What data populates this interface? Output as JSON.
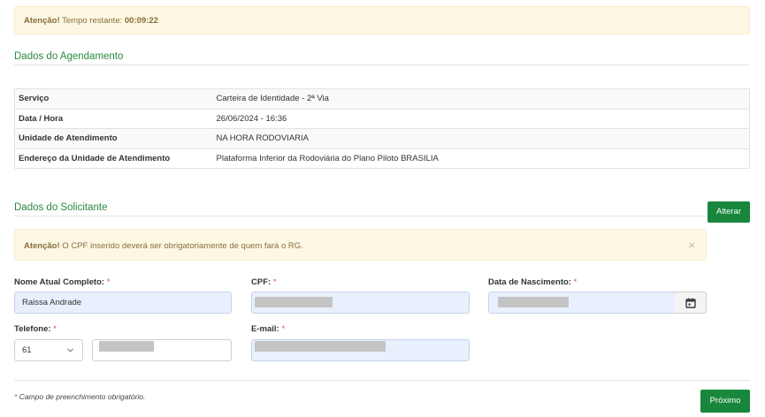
{
  "timer_alert": {
    "prefix": "Atenção!",
    "text": "Tempo restante:",
    "time": "00:09:22"
  },
  "agendamento": {
    "title": "Dados do Agendamento",
    "rows": [
      {
        "label": "Serviço",
        "value": "Carteira de Identidade - 2ª Via"
      },
      {
        "label": "Data / Hora",
        "value": "26/06/2024 - 16:36"
      },
      {
        "label": "Unidade de Atendimento",
        "value": "NA HORA RODOVIARIA"
      },
      {
        "label": "Endereço da Unidade de Atendimento",
        "value": "Plataforma Inferior da Rodoviária do Plano Piloto BRASILIA"
      }
    ]
  },
  "solicitante": {
    "title": "Dados do Solicitante",
    "edit_button": "Alterar",
    "alert_prefix": "Atenção!",
    "alert_text": "O CPF inserido deverá ser obrigatoriamente de quem fará o RG.",
    "alert_close": "×",
    "fields": {
      "nome": {
        "label": "Nome Atual Completo:",
        "value": "Raissa Andrade"
      },
      "cpf": {
        "label": "CPF:"
      },
      "nascimento": {
        "label": "Data de Nascimento:"
      },
      "telefone": {
        "label": "Telefone:",
        "ddd": "61"
      },
      "email": {
        "label": "E-mail:"
      }
    },
    "required_mark": "*"
  },
  "footer": {
    "note_mark": "*",
    "note": "Campo de preenchimento obrigatório.",
    "next_button": "Próximo"
  },
  "colors": {
    "accent": "#18873c",
    "title": "#2b8a3e",
    "alert_bg": "#fcf8e3",
    "alert_text": "#8a6d3b",
    "required": "#d9534f"
  },
  "icons": {
    "calendar": "calendar-icon",
    "chevron": "chevron-down-icon",
    "close": "close-icon"
  }
}
